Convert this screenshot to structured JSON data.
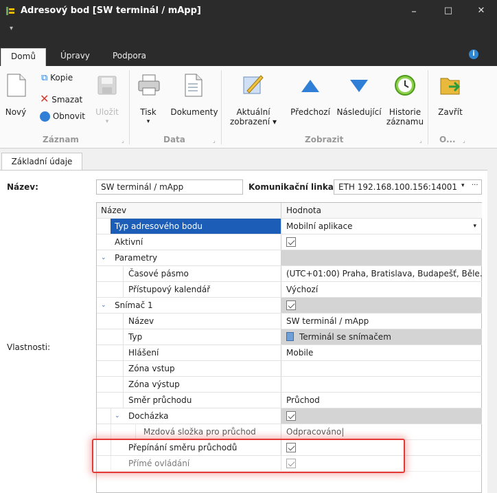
{
  "window": {
    "title": "Adresový bod [SW terminál / mApp]",
    "controls": {
      "minimize": "–",
      "maximize": "□",
      "close": "✕"
    }
  },
  "tabs": [
    {
      "label": "Domů",
      "active": true
    },
    {
      "label": "Úpravy",
      "active": false
    },
    {
      "label": "Podpora",
      "active": false
    }
  ],
  "ribbon": {
    "zaznam": {
      "group_label": "Záznam",
      "novy": "Nový",
      "kopie": "Kopie",
      "smazat": "Smazat",
      "obnovit": "Obnovit",
      "ulozit": "Uložit"
    },
    "data": {
      "group_label": "Data",
      "tisk": "Tisk",
      "dokumenty": "Dokumenty"
    },
    "zobrazit": {
      "group_label": "Zobrazit",
      "aktualni_1": "Aktuální",
      "aktualni_2": "zobrazení ▾",
      "predchozi": "Předchozí",
      "nasledujici": "Následující",
      "historie_1": "Historie",
      "historie_2": "záznamu"
    },
    "other": {
      "group_label": "O...",
      "zavrit": "Zavřít"
    }
  },
  "content_tab": "Základní údaje",
  "form": {
    "nazev_label": "Název:",
    "nazev_value": "SW terminál / mApp",
    "linka_label": "Komunikační linka:",
    "linka_value": "ETH 192.168.100.156:14001",
    "ellipsis": "···",
    "vlastnosti_label": "Vlastnosti:"
  },
  "grid": {
    "col_name": "Název",
    "col_value": "Hodnota",
    "rows": [
      {
        "name": "Typ adresového bodu",
        "value": "Mobilní aplikace"
      },
      {
        "name": "Aktivní",
        "value": ""
      },
      {
        "name": "Parametry",
        "value": ""
      },
      {
        "name": "Časové pásmo",
        "value": "(UTC+01:00) Praha, Bratislava, Budapešť, Běle..."
      },
      {
        "name": "Přístupový kalendář",
        "value": "Výchozí"
      },
      {
        "name": "Snímač 1",
        "value": ""
      },
      {
        "name": "Název",
        "value": "SW terminál / mApp"
      },
      {
        "name": "Typ",
        "value": "Terminál se snímačem"
      },
      {
        "name": "Hlášení",
        "value": "Mobile"
      },
      {
        "name": "Zóna vstup",
        "value": ""
      },
      {
        "name": "Zóna výstup",
        "value": ""
      },
      {
        "name": "Směr průchodu",
        "value": "Průchod"
      },
      {
        "name": "Docházka",
        "value": ""
      },
      {
        "name": "Mzdová složka pro průchod",
        "value": "Odpracováno"
      },
      {
        "name": "Přepínání směru průchodů",
        "value": ""
      },
      {
        "name": "Přímé ovládání",
        "value": ""
      }
    ]
  },
  "colors": {
    "titlebar": "#2b2b2b",
    "selection": "#1c5db8",
    "highlight": "#e53935",
    "accent": "#2f86d1"
  }
}
